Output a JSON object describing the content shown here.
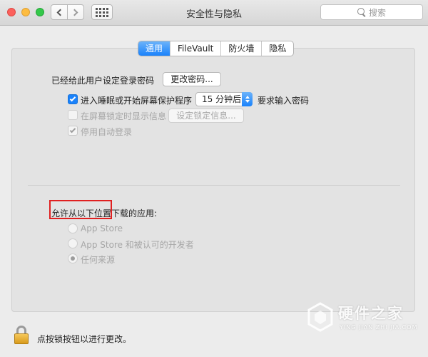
{
  "window": {
    "title": "安全性与隐私",
    "search_placeholder": "搜索"
  },
  "tabs": [
    {
      "label": "通用",
      "active": true
    },
    {
      "label": "FileVault",
      "active": false
    },
    {
      "label": "防火墙",
      "active": false
    },
    {
      "label": "隐私",
      "active": false
    }
  ],
  "general": {
    "password_label": "已经给此用户设定登录密码",
    "change_password_button": "更改密码...",
    "require_password": {
      "checked": true,
      "label": "进入睡眠或开始屏幕保护程序",
      "delay_value": "15 分钟后",
      "suffix": "要求输入密码"
    },
    "lock_message": {
      "checked": false,
      "label": "在屏幕锁定时显示信息",
      "button": "设定锁定信息..."
    },
    "disable_auto_login": {
      "checked": true,
      "label": "停用自动登录"
    }
  },
  "downloads": {
    "heading": "允许从以下位置下载的应用:",
    "options": [
      {
        "label": "App Store",
        "selected": false
      },
      {
        "label": "App Store 和被认可的开发者",
        "selected": false
      },
      {
        "label": "任何来源",
        "selected": true
      }
    ]
  },
  "footer": {
    "lock_text": "点按锁按钮以进行更改。"
  },
  "watermark": {
    "title": "硬件之家",
    "subtitle": "YING JIAN ZHI JIA.COM"
  },
  "colors": {
    "accent": "#1a82fb",
    "highlight": "#e02020"
  }
}
